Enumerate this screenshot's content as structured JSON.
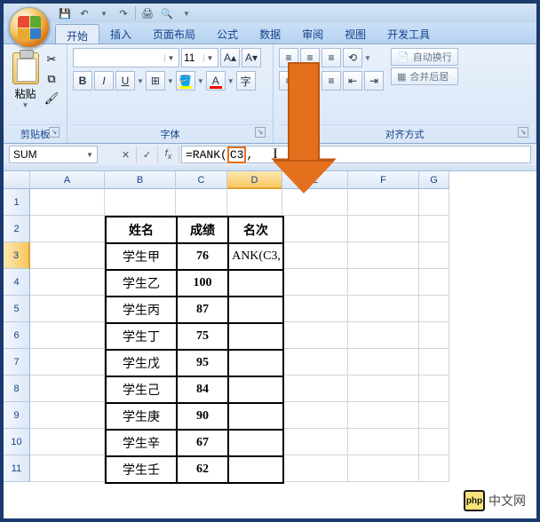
{
  "qat": {
    "save": "💾",
    "undo": "↶",
    "redo": "↷",
    "print": "🖨",
    "preview": "🔍"
  },
  "tabs": [
    "开始",
    "插入",
    "页面布局",
    "公式",
    "数据",
    "审阅",
    "视图",
    "开发工具"
  ],
  "ribbon": {
    "clipboard": {
      "paste": "粘贴",
      "label": "剪贴板"
    },
    "font": {
      "size": "11",
      "label": "字体",
      "bold": "B",
      "italic": "I",
      "underline": "U"
    },
    "align": {
      "label": "对齐方式",
      "wrap": "自动换行",
      "merge": "合并后居"
    }
  },
  "namebox": "SUM",
  "formula": {
    "pre": "=RANK",
    "lp": "(",
    "hl": "C3",
    "post": ","
  },
  "columns": [
    "A",
    "B",
    "C",
    "D",
    "E",
    "F",
    "G"
  ],
  "rows": [
    "1",
    "2",
    "3",
    "4",
    "5",
    "6",
    "7",
    "8",
    "9",
    "10",
    "11"
  ],
  "table": {
    "headers": {
      "name": "姓名",
      "score": "成绩",
      "rank": "名次"
    },
    "d3": "ANK(C3,",
    "data": [
      {
        "name": "学生甲",
        "score": "76"
      },
      {
        "name": "学生乙",
        "score": "100"
      },
      {
        "name": "学生丙",
        "score": "87"
      },
      {
        "name": "学生丁",
        "score": "75"
      },
      {
        "name": "学生戊",
        "score": "95"
      },
      {
        "name": "学生己",
        "score": "84"
      },
      {
        "name": "学生庚",
        "score": "90"
      },
      {
        "name": "学生辛",
        "score": "67"
      },
      {
        "name": "学生壬",
        "score": "62"
      }
    ]
  },
  "watermark": {
    "logo": "php",
    "text": "中文网"
  },
  "chart_data": {
    "type": "table",
    "title": "",
    "columns": [
      "姓名",
      "成绩",
      "名次"
    ],
    "rows": [
      [
        "学生甲",
        76,
        null
      ],
      [
        "学生乙",
        100,
        null
      ],
      [
        "学生丙",
        87,
        null
      ],
      [
        "学生丁",
        75,
        null
      ],
      [
        "学生戊",
        95,
        null
      ],
      [
        "学生己",
        84,
        null
      ],
      [
        "学生庚",
        90,
        null
      ],
      [
        "学生辛",
        67,
        null
      ],
      [
        "学生壬",
        62,
        null
      ]
    ]
  }
}
